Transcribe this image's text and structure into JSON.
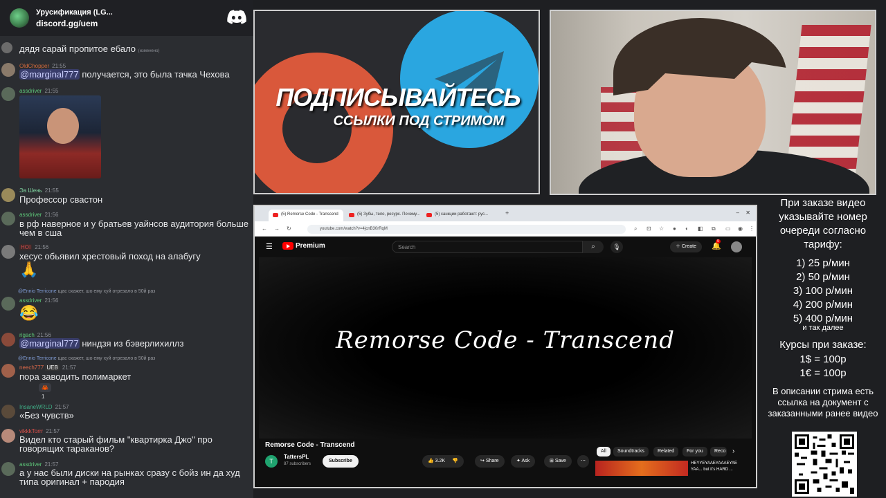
{
  "chat": {
    "server_name": "Урусификация (LG...",
    "invite_link": "discord.gg/uem",
    "messages": [
      {
        "text": "дядя сарай пропитое ебало",
        "suffix": "(изменено)"
      },
      {
        "author": "OldChopper",
        "time": "21:55",
        "mention": "@marginal777",
        "text": "получается, это была тачка Чехова"
      },
      {
        "author": "assdriver",
        "time": "21:55"
      },
      {
        "author": "Эа Шень",
        "time": "21:55",
        "text": "Профессор свастон"
      },
      {
        "author": "assdriver",
        "time": "21:56",
        "text": "в рф наверное и у братьев уайнсов аудитория больше чем в сша"
      },
      {
        "tag": "HOI",
        "time": "21:56",
        "text": "хесус обьявил хрестовый поход на алабугу",
        "emoji": "🙏"
      },
      {
        "reply_author": "@Ennio Terricone",
        "reply_text": "щас скажет, шо ему хуй отрезало в 50й раз",
        "author": "assdriver",
        "time": "21:56",
        "emoji": "😂"
      },
      {
        "author": "rigach",
        "time": "21:56",
        "mention": "@marginal777",
        "text": "ниндзя из бэверлихиллз"
      },
      {
        "reply_author": "@Ennio Terricone",
        "reply_text": "щас скажет, шо ему хуй отрезало в 50й раз",
        "author": "neech777",
        "tag": "UEB",
        "time": "21:57",
        "text": "пора заводить полимаркет",
        "reaction_count": "1"
      },
      {
        "author": "InsaneWRLD",
        "time": "21:57",
        "text": "«Без чувств»"
      },
      {
        "author": "vikkkTorrr",
        "time": "21:57",
        "text": "Видел кто старый фильм \"квартирка Джо\" про говорящих тараканов?"
      },
      {
        "author": "assdriver",
        "time": "21:57",
        "text": "а у нас были диски на рынках сразу с бойз ин да худ типа оригинал + пародия"
      }
    ]
  },
  "banner": {
    "title": "ПОДПИСЫВАЙТЕСЬ",
    "subtitle": "ССЫЛКИ ПОД СТРИМОМ"
  },
  "browser": {
    "tabs": [
      "(5) Remorse Code - Transcend",
      "(5) Зубы, тело, ресурс. Почему...",
      "(5) санкции работают: рус..."
    ],
    "url": "youtube.com/watch?v=4jcnB30rRqM",
    "youtube": {
      "logo": "Premium",
      "search_placeholder": "Search",
      "create_label": "Create",
      "notif_count": "9",
      "video_overlay": "Remorse Code - Transcend",
      "video_title": "Remorse Code - Transcend",
      "channel_initial": "T",
      "channel_name": "TattersPL",
      "subscribers": "87 subscribers",
      "subscribe_label": "Subscribe",
      "likes": "3.2K",
      "share_label": "Share",
      "ask_label": "Ask",
      "save_label": "Save",
      "chips": [
        "All",
        "Soundtracks",
        "Related",
        "For you",
        "Reco"
      ],
      "rec_title": "HEYYEYAAEYAAAEYAE YAA... but it's HARD ..."
    }
  },
  "info": {
    "heading": "При заказе видео указывайте номер очереди согласно тарифу:",
    "tiers": [
      "1) 25 р/мин",
      "2) 50 р/мин",
      "3) 100 р/мин",
      "4) 200 р/мин",
      "5) 400 р/мин"
    ],
    "etc": "и так далее",
    "rates_heading": "Курсы при заказе:",
    "rates": [
      "1$ = 100р",
      "1€ = 100р"
    ],
    "description": "В описании стрима есть ссылка на документ с заказанными ранее видео"
  }
}
